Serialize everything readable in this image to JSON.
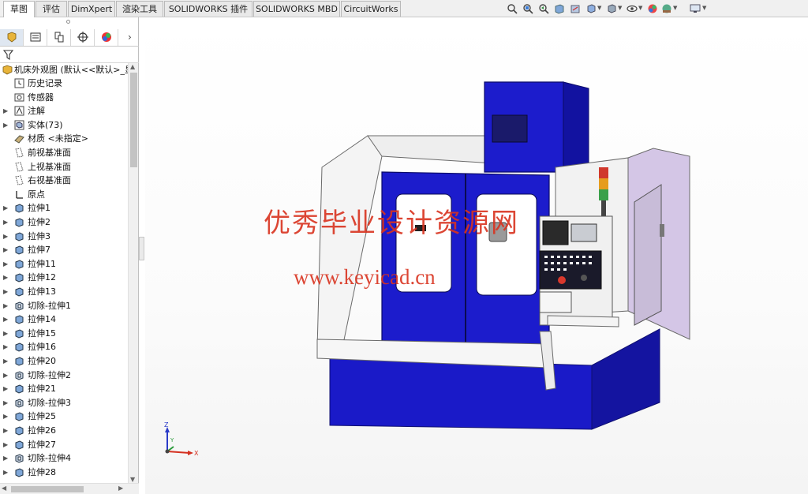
{
  "tabs": [
    {
      "label": "草图",
      "active": true
    },
    {
      "label": "评估",
      "active": false
    },
    {
      "label": "DimXpert",
      "active": false
    },
    {
      "label": "渲染工具",
      "active": false
    },
    {
      "label": "SOLIDWORKS 插件",
      "active": false
    },
    {
      "label": "SOLIDWORKS MBD",
      "active": false
    },
    {
      "label": "CircuitWorks",
      "active": false
    }
  ],
  "view_toolbar_icons": [
    "zoom-to-fit-icon",
    "zoom-area-icon",
    "previous-view-icon",
    "section-view-icon",
    "dynamic-annotation-icon",
    "view-orientation-icon",
    "display-style-icon",
    "hide-show-icon",
    "edit-appearance-icon",
    "apply-scene-icon",
    "view-settings-icon"
  ],
  "panel_tabs": [
    "feature-manager-icon",
    "property-manager-icon",
    "configuration-manager-icon",
    "dimxpert-manager-icon",
    "display-manager-icon"
  ],
  "tree": {
    "root": "机床外观图  (默认<<默认>_显",
    "items": [
      {
        "label": "历史记录",
        "icon": "history-icon",
        "expandable": false
      },
      {
        "label": "传感器",
        "icon": "sensor-icon",
        "expandable": false
      },
      {
        "label": "注解",
        "icon": "annotation-icon",
        "expandable": true
      },
      {
        "label": "实体(73)",
        "icon": "solid-bodies-icon",
        "expandable": true
      },
      {
        "label": "材质 <未指定>",
        "icon": "material-icon",
        "expandable": false
      },
      {
        "label": "前视基准面",
        "icon": "plane-icon",
        "expandable": false
      },
      {
        "label": "上视基准面",
        "icon": "plane-icon",
        "expandable": false
      },
      {
        "label": "右视基准面",
        "icon": "plane-icon",
        "expandable": false
      },
      {
        "label": "原点",
        "icon": "origin-icon",
        "expandable": false
      },
      {
        "label": "拉伸1",
        "icon": "extrude-icon",
        "expandable": true
      },
      {
        "label": "拉伸2",
        "icon": "extrude-icon",
        "expandable": true
      },
      {
        "label": "拉伸3",
        "icon": "extrude-icon",
        "expandable": true
      },
      {
        "label": "拉伸7",
        "icon": "extrude-icon",
        "expandable": true
      },
      {
        "label": "拉伸11",
        "icon": "extrude-icon",
        "expandable": true
      },
      {
        "label": "拉伸12",
        "icon": "extrude-icon",
        "expandable": true
      },
      {
        "label": "拉伸13",
        "icon": "extrude-icon",
        "expandable": true
      },
      {
        "label": "切除-拉伸1",
        "icon": "cut-extrude-icon",
        "expandable": true
      },
      {
        "label": "拉伸14",
        "icon": "extrude-icon",
        "expandable": true
      },
      {
        "label": "拉伸15",
        "icon": "extrude-icon",
        "expandable": true
      },
      {
        "label": "拉伸16",
        "icon": "extrude-icon",
        "expandable": true
      },
      {
        "label": "拉伸20",
        "icon": "extrude-icon",
        "expandable": true
      },
      {
        "label": "切除-拉伸2",
        "icon": "cut-extrude-icon",
        "expandable": true
      },
      {
        "label": "拉伸21",
        "icon": "extrude-icon",
        "expandable": true
      },
      {
        "label": "切除-拉伸3",
        "icon": "cut-extrude-icon",
        "expandable": true
      },
      {
        "label": "拉伸25",
        "icon": "extrude-icon",
        "expandable": true
      },
      {
        "label": "拉伸26",
        "icon": "extrude-icon",
        "expandable": true
      },
      {
        "label": "拉伸27",
        "icon": "extrude-icon",
        "expandable": true
      },
      {
        "label": "切除-拉伸4",
        "icon": "cut-extrude-icon",
        "expandable": true
      },
      {
        "label": "拉伸28",
        "icon": "extrude-icon",
        "expandable": true
      }
    ]
  },
  "viewport": {
    "watermark_title": "优秀毕业设计资源网",
    "watermark_url": "www.keyicad.cn",
    "triad": {
      "z": "Z",
      "y": "Y",
      "x": "X"
    }
  },
  "colors": {
    "machine_blue": "#1a1ac8",
    "machine_white": "#f4f4f4",
    "side_panel": "#d4c6e6",
    "watermark": "#d9331f"
  }
}
